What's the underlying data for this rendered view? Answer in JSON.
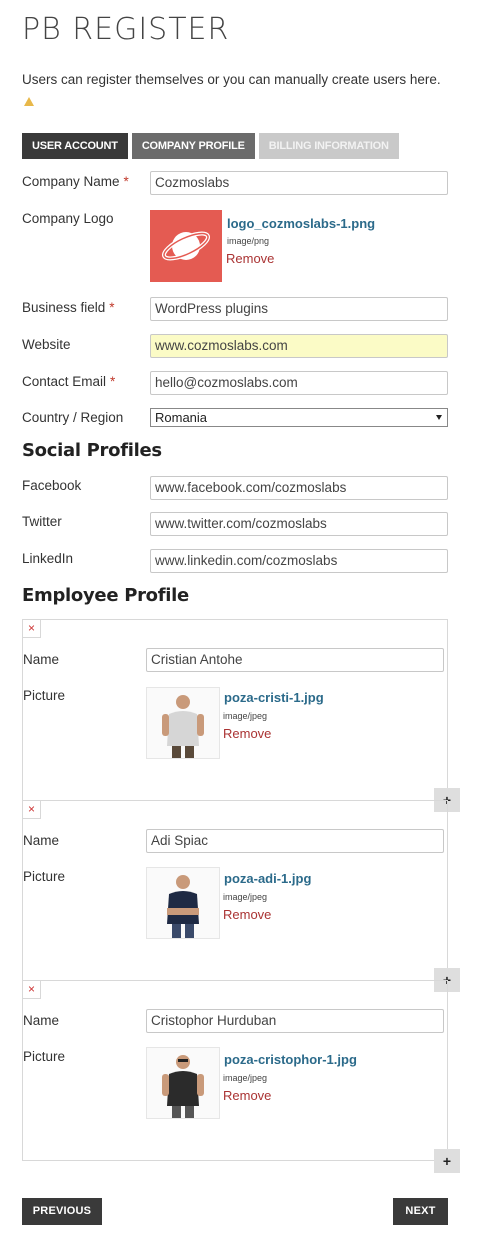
{
  "page_title": "PB REGISTER",
  "intro_text": "Users can register themselves or you can manually create users here.",
  "tabs": [
    {
      "label": "USER ACCOUNT",
      "state": "active"
    },
    {
      "label": "COMPANY PROFILE",
      "state": "normal"
    },
    {
      "label": "BILLING INFORMATION",
      "state": "disabled"
    }
  ],
  "company": {
    "name_label": "Company Name",
    "name_value": "Cozmoslabs",
    "logo_label": "Company Logo",
    "logo_file": "logo_cozmoslabs-1.png",
    "logo_type": "image/png",
    "logo_remove": "Remove",
    "business_label": "Business field",
    "business_value": "WordPress plugins",
    "website_label": "Website",
    "website_value": "www.cozmoslabs.com",
    "email_label": "Contact Email",
    "email_value": "hello@cozmoslabs.com",
    "country_label": "Country / Region",
    "country_value": "Romania"
  },
  "required_mark": "*",
  "social": {
    "title": "Social Profiles",
    "facebook_label": "Facebook",
    "facebook_value": "www.facebook.com/cozmoslabs",
    "twitter_label": "Twitter",
    "twitter_value": "www.twitter.com/cozmoslabs",
    "linkedin_label": "LinkedIn",
    "linkedin_value": "www.linkedin.com/cozmoslabs"
  },
  "employees": {
    "title": "Employee Profile",
    "name_label": "Name",
    "picture_label": "Picture",
    "remove_label": "Remove",
    "remove_entry_symbol": "×",
    "add_entry_symbol": "+",
    "items": [
      {
        "name": "Cristian Antohe",
        "file": "poza-cristi-1.jpg",
        "type": "image/jpeg",
        "shirt": "#d6d6d6"
      },
      {
        "name": "Adi Spiac",
        "file": "poza-adi-1.jpg",
        "type": "image/jpeg",
        "shirt": "#1e2a44"
      },
      {
        "name": "Cristophor Hurduban",
        "file": "poza-cristophor-1.jpg",
        "type": "image/jpeg",
        "shirt": "#2b2b2b"
      }
    ]
  },
  "nav": {
    "previous": "PREVIOUS",
    "next": "NEXT"
  },
  "colors": {
    "accent_dark": "#3a3a3a",
    "link": "#2b6a8a",
    "remove": "#a33333",
    "logo_bg": "#e45b52",
    "highlight_input": "#fbfbc6"
  }
}
